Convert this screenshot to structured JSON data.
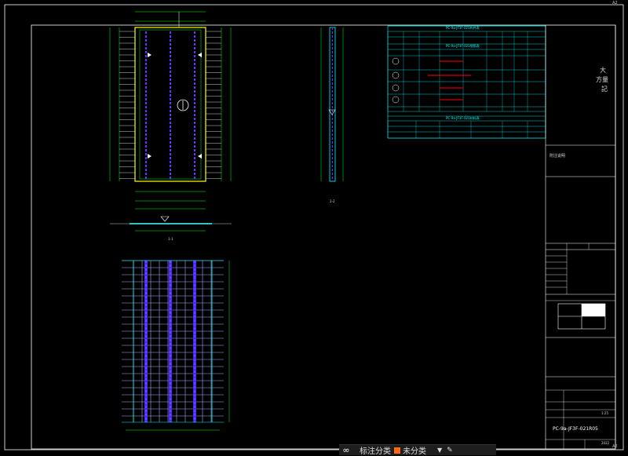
{
  "corner_marks": {
    "top_right": "A2",
    "bottom_right": "A2"
  },
  "title_block": {
    "side_title_chars": [
      "大",
      "方量",
      "記"
    ],
    "remark_label": "附注说明",
    "drawing_number": "PC-9a-JF3F-021R05",
    "scale": "1:25",
    "sheet": "2022"
  },
  "section_labels": {
    "plan_mark": "1-1",
    "side_mark": "2-2"
  },
  "tables": {
    "header_1": "PC-9a-JF3F-021构件表",
    "header_2": "PC-9a-JF3F-021钢筋表",
    "header_3": "PC-9a-JF3F-021材料表",
    "row_ids": [
      "1",
      "2",
      "3",
      "4"
    ]
  },
  "colors": {
    "yellow": "#ffff00",
    "green": "#00ff00",
    "cyan": "#00ffff",
    "blue": "#2222ff",
    "magenta": "#cc33ff",
    "white": "#ffffff",
    "red": "#ff0000"
  },
  "bottombar": {
    "visibility_icon": "infinity-icon",
    "annotate_label": "标注分类",
    "layer_label": "未分类",
    "dropdown_icon": "chevron-down-icon",
    "edit_icon": "pen-icon"
  }
}
